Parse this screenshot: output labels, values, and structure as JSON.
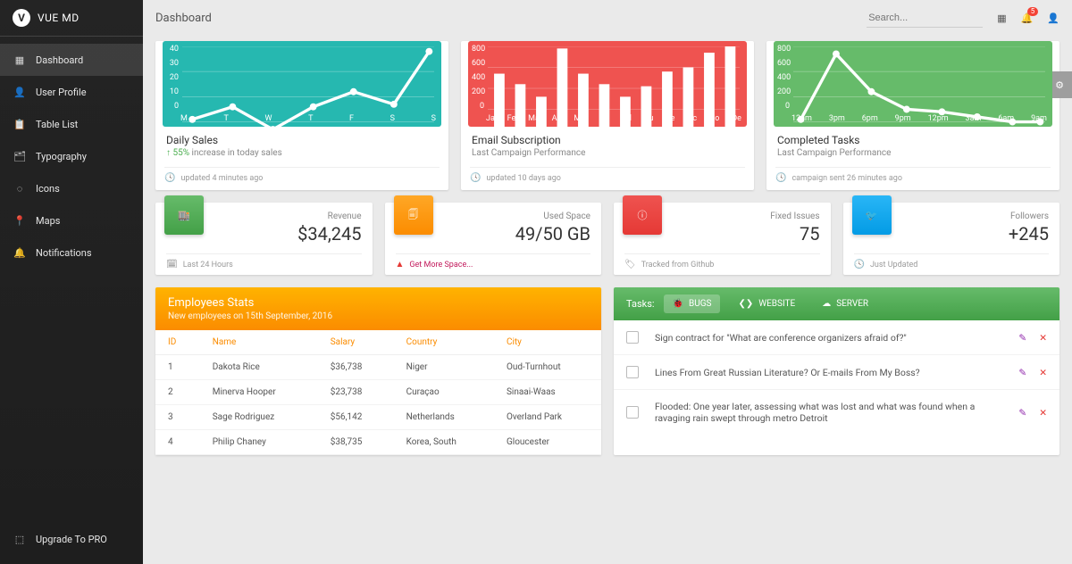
{
  "brand": {
    "name": "VUE MD"
  },
  "sidebar": {
    "items": [
      {
        "label": "Dashboard"
      },
      {
        "label": "User Profile"
      },
      {
        "label": "Table List"
      },
      {
        "label": "Typography"
      },
      {
        "label": "Icons"
      },
      {
        "label": "Maps"
      },
      {
        "label": "Notifications"
      }
    ],
    "upgrade": "Upgrade To PRO"
  },
  "header": {
    "title": "Dashboard",
    "search_placeholder": "Search...",
    "notification_count": "5"
  },
  "chart_data": [
    {
      "type": "line",
      "title": "Daily Sales",
      "subtitle_prefix": "↑ 55% ",
      "subtitle": "increase in today sales",
      "footer": "updated 4 minutes ago",
      "y_ticks": [
        "40",
        "30",
        "20",
        "10",
        "0"
      ],
      "categories": [
        "M",
        "T",
        "W",
        "T",
        "F",
        "S",
        "S"
      ],
      "values": [
        11,
        16,
        7,
        16,
        22,
        17,
        38
      ]
    },
    {
      "type": "bar",
      "title": "Email Subscription",
      "subtitle": "Last Campaign Performance",
      "footer": "updated 10 days ago",
      "y_ticks": [
        "800",
        "600",
        "400",
        "200",
        "0"
      ],
      "categories": [
        "Ja",
        "Fe",
        "Ma",
        "Ap",
        "Mai",
        "Ju",
        "Jul",
        "Au",
        "Se",
        "Oc",
        "No",
        "De"
      ],
      "values": [
        540,
        440,
        320,
        780,
        550,
        450,
        320,
        430,
        560,
        610,
        750,
        890
      ]
    },
    {
      "type": "line",
      "title": "Completed Tasks",
      "subtitle": "Last Campaign Performance",
      "footer": "campaign sent 26 minutes ago",
      "y_ticks": [
        "800",
        "600",
        "400",
        "200",
        "0"
      ],
      "categories": [
        "12am",
        "3pm",
        "6pm",
        "9pm",
        "12pm",
        "3am",
        "6am",
        "9am"
      ],
      "values": [
        230,
        740,
        440,
        300,
        280,
        240,
        200,
        190
      ]
    }
  ],
  "stats": [
    {
      "label": "Revenue",
      "value": "$34,245",
      "footer": "Last 24 Hours",
      "icon": "store-icon",
      "color": "green"
    },
    {
      "label": "Used Space",
      "value": "49/50 GB",
      "footer": "Get More Space...",
      "icon": "copy-icon",
      "color": "orange",
      "footer_link": true,
      "footer_icon": "warning"
    },
    {
      "label": "Fixed Issues",
      "value": "75",
      "footer": "Tracked from Github",
      "icon": "info-icon",
      "color": "red",
      "footer_icon": "tag"
    },
    {
      "label": "Followers",
      "value": "+245",
      "footer": "Just Updated",
      "icon": "twitter-icon",
      "color": "blue",
      "footer_icon": "clock"
    }
  ],
  "employees": {
    "title": "Employees Stats",
    "subtitle": "New employees on 15th September, 2016",
    "columns": [
      "ID",
      "Name",
      "Salary",
      "Country",
      "City"
    ],
    "rows": [
      [
        "1",
        "Dakota Rice",
        "$36,738",
        "Niger",
        "Oud-Turnhout"
      ],
      [
        "2",
        "Minerva Hooper",
        "$23,738",
        "Curaçao",
        "Sinaai-Waas"
      ],
      [
        "3",
        "Sage Rodriguez",
        "$56,142",
        "Netherlands",
        "Overland Park"
      ],
      [
        "4",
        "Philip Chaney",
        "$38,735",
        "Korea, South",
        "Gloucester"
      ]
    ]
  },
  "tasks": {
    "label": "Tasks:",
    "tabs": [
      "BUGS",
      "WEBSITE",
      "SERVER"
    ],
    "items": [
      "Sign contract for \"What are conference organizers afraid of?\"",
      "Lines From Great Russian Literature? Or E-mails From My Boss?",
      "Flooded: One year later, assessing what was lost and what was found when a ravaging rain swept through metro Detroit"
    ]
  }
}
